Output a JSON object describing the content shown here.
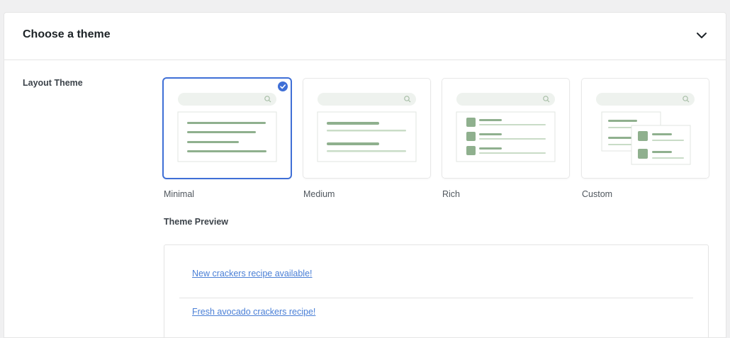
{
  "panel": {
    "title": "Choose a theme",
    "toggle_icon": "chevron-down-icon"
  },
  "layout_theme": {
    "label": "Layout Theme",
    "options": [
      {
        "label": "Minimal",
        "selected": true
      },
      {
        "label": "Medium",
        "selected": false
      },
      {
        "label": "Rich",
        "selected": false
      },
      {
        "label": "Custom",
        "selected": false
      }
    ]
  },
  "preview": {
    "label": "Theme Preview",
    "links": [
      "New crackers recipe available!",
      "Fresh avocado crackers recipe!"
    ]
  },
  "colors": {
    "accent": "#3f6fd6",
    "thumb_dark": "#8fb08e",
    "thumb_light": "#c9dcc7",
    "search_bar": "#eef2ee",
    "link": "#4a7fd6"
  }
}
